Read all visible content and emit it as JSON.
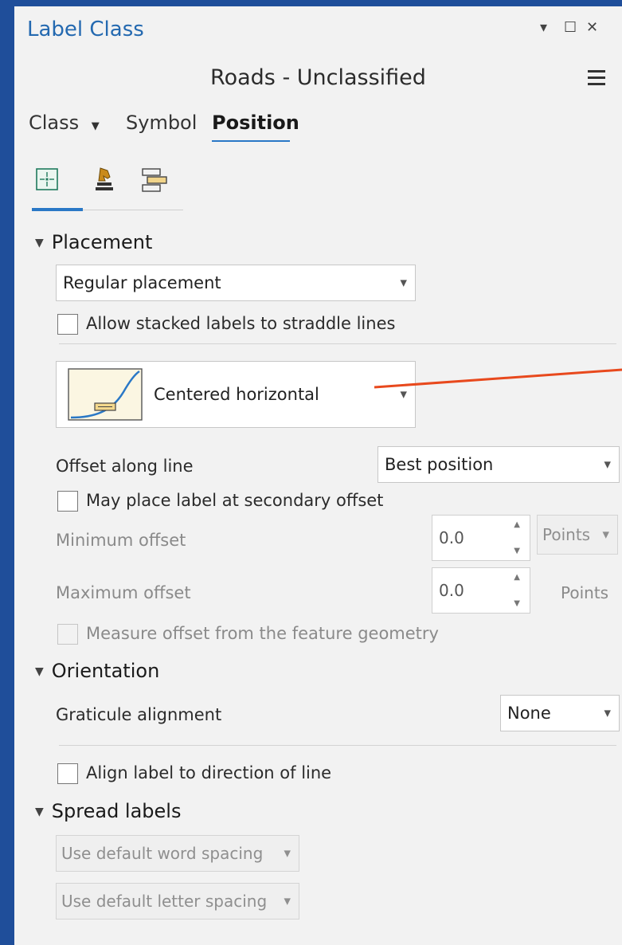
{
  "window": {
    "title": "Label Class",
    "controls": {
      "pin": "▾",
      "maximize": "☐",
      "close": "✕"
    }
  },
  "layer_title": "Roads - Unclassified",
  "tabs": [
    {
      "label": "Class",
      "has_dropdown": true
    },
    {
      "label": "Symbol"
    },
    {
      "label": "Position",
      "active": true
    }
  ],
  "subtab_icons": [
    "placement-crosshair-icon",
    "chess-knight-icon",
    "fitting-strategy-icon"
  ],
  "placement": {
    "section_label": "Placement",
    "placement_type": "Regular placement",
    "straddle_checkbox_label": "Allow stacked labels to straddle lines",
    "position_style": "Centered horizontal",
    "offset_along_line_label": "Offset along line",
    "offset_along_line_value": "Best position",
    "secondary_offset_label": "May place label at secondary offset",
    "min_offset_label": "Minimum offset",
    "min_offset_value": "0.0",
    "min_offset_unit": "Points",
    "max_offset_label": "Maximum offset",
    "max_offset_value": "0.0",
    "max_offset_unit": "Points",
    "measure_offset_label": "Measure offset from the feature geometry"
  },
  "orientation": {
    "section_label": "Orientation",
    "graticule_label": "Graticule alignment",
    "graticule_value": "None",
    "align_direction_label": "Align label to direction of line"
  },
  "spread": {
    "section_label": "Spread labels",
    "word_spacing": "Use default word spacing",
    "letter_spacing": "Use default letter spacing"
  },
  "colors": {
    "background": "#1f4e9a",
    "accent": "#2a78c6",
    "annotation_line": "#e8491d"
  }
}
